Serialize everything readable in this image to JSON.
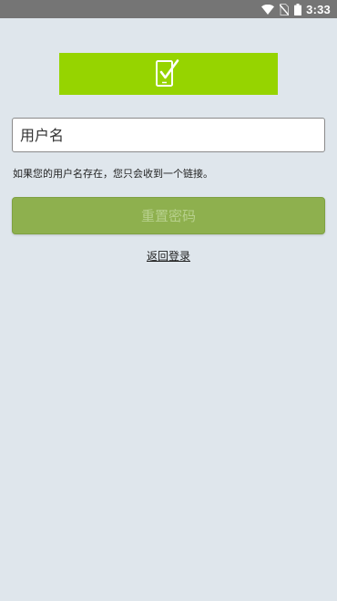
{
  "status_bar": {
    "time": "3:33",
    "icons": [
      "wifi-icon",
      "no-sim-icon",
      "battery-icon"
    ],
    "background": "#757575"
  },
  "logo": {
    "icon": "phone-check-icon",
    "color": "#96d400"
  },
  "form": {
    "username_placeholder": "用户名",
    "username_value": "",
    "hint": "如果您的用户名存在，您只会收到一个链接。",
    "reset_label": "重置密码",
    "back_label": "返回登录"
  },
  "colors": {
    "background": "#dfe6ec",
    "button": "#8eb04e",
    "button_text": "#b7d08c"
  }
}
